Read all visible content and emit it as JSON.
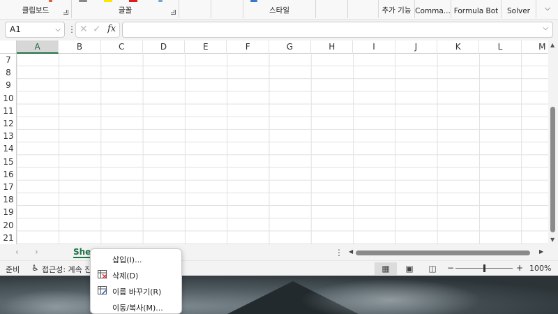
{
  "ribbon": {
    "groups": [
      {
        "label": "클립보드"
      },
      {
        "label": "글꼴"
      },
      {
        "label": "스타일"
      },
      {
        "label": "추가 기능"
      },
      {
        "label": "Comma..."
      },
      {
        "label": "Formula Bot"
      },
      {
        "label": "Solver"
      }
    ],
    "collapse_icon": "chevron-down-icon"
  },
  "formula_bar": {
    "name_box": "A1",
    "formula": "",
    "fx_label": "fx"
  },
  "grid": {
    "columns": [
      "A",
      "B",
      "C",
      "D",
      "E",
      "F",
      "G",
      "H",
      "I",
      "J",
      "K",
      "L",
      "M"
    ],
    "selected_column": "A",
    "rows": [
      "7",
      "8",
      "9",
      "10",
      "11",
      "12",
      "13",
      "14",
      "15",
      "16",
      "17",
      "18",
      "19",
      "20",
      "21"
    ]
  },
  "sheet_tabs": {
    "active_tab": "Shee",
    "more_icon": "more-vertical-icon"
  },
  "status_bar": {
    "ready": "준비",
    "accessibility": "접근성: 계속 진",
    "zoom": "100%",
    "zoom_minus": "−",
    "zoom_plus": "+",
    "zoom_level": 0.5
  },
  "context_menu": {
    "items": [
      {
        "label": "삽입(I)...",
        "icon": ""
      },
      {
        "label": "삭제(D)",
        "icon": "delete-sheet-icon"
      },
      {
        "label": "이름 바꾸기(R)",
        "icon": "rename-sheet-icon"
      },
      {
        "label": "이동/복사(M)...",
        "icon": ""
      }
    ]
  }
}
